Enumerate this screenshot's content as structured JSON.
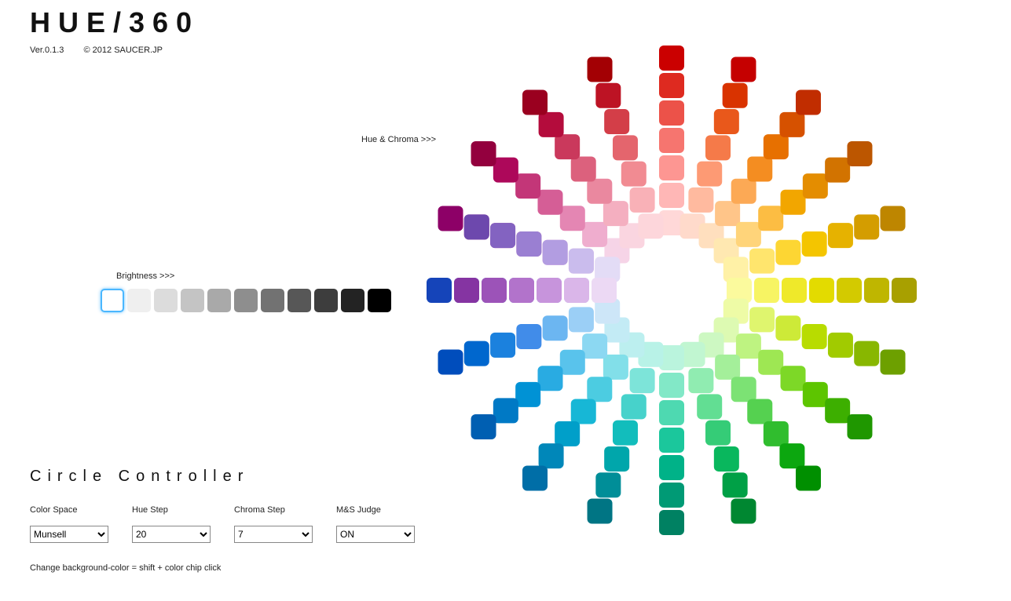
{
  "header": {
    "logo": "HUE/360",
    "version": "Ver.0.1.3",
    "copyright": "© 2012 SAUCER.JP"
  },
  "labels": {
    "hue_chroma": "Hue & Chroma >>>",
    "brightness": "Brightness >>>"
  },
  "brightness": {
    "selected_index": 0,
    "swatches": [
      "#ffffff",
      "#efefef",
      "#dcdcdc",
      "#c4c4c4",
      "#a9a9a9",
      "#8e8e8e",
      "#727272",
      "#575757",
      "#3d3d3d",
      "#232323",
      "#000000"
    ]
  },
  "wheel": {
    "hue_count": 20,
    "chroma_steps": 7,
    "spokes": [
      {
        "angle": -90,
        "colors": [
          "#ffd8d8",
          "#ffb7b6",
          "#fd9692",
          "#f6756f",
          "#ec5249",
          "#de2a20",
          "#cb0000"
        ]
      },
      {
        "angle": -72,
        "colors": [
          "#ffdacb",
          "#ffba9f",
          "#fd9a74",
          "#f57a49",
          "#e9581b",
          "#d93300",
          "#c50000"
        ]
      },
      {
        "angle": -54,
        "colors": [
          "#ffdfbe",
          "#ffc589",
          "#fca955",
          "#f48d21",
          "#e77000",
          "#d65100",
          "#c12d00"
        ]
      },
      {
        "angle": -36,
        "colors": [
          "#ffe8b1",
          "#ffd47a",
          "#fcbd43",
          "#f2a600",
          "#e48d00",
          "#d27300",
          "#bc5600"
        ]
      },
      {
        "angle": -18,
        "colors": [
          "#fff1a6",
          "#ffe56d",
          "#fdd633",
          "#f4c500",
          "#e6b200",
          "#d49d00",
          "#be8600"
        ]
      },
      {
        "angle": 0,
        "colors": [
          "#fbfa9d",
          "#f7f463",
          "#efe92a",
          "#e3db00",
          "#d3ca00",
          "#bfb600",
          "#a8a000"
        ]
      },
      {
        "angle": 18,
        "colors": [
          "#eefba6",
          "#dff56e",
          "#cdea38",
          "#b8dc00",
          "#a1cb00",
          "#88b700",
          "#6da000"
        ]
      },
      {
        "angle": 36,
        "colors": [
          "#ddfab2",
          "#bef381",
          "#9ee753",
          "#7dd827",
          "#5dc500",
          "#3daf00",
          "#1f9700"
        ]
      },
      {
        "angle": 54,
        "colors": [
          "#cdf8c2",
          "#a4ef9a",
          "#7ce274",
          "#55d150",
          "#30bd2e",
          "#0ca70f",
          "#008f00"
        ]
      },
      {
        "angle": 72,
        "colors": [
          "#c1f6d1",
          "#90ecb1",
          "#62de93",
          "#35cc77",
          "#09b75d",
          "#00a046",
          "#008731"
        ]
      },
      {
        "angle": 90,
        "colors": [
          "#baf4dd",
          "#82e8c7",
          "#4ed9b1",
          "#1bc79c",
          "#00b288",
          "#009a75",
          "#008162"
        ]
      },
      {
        "angle": 108,
        "colors": [
          "#b8f2e7",
          "#7de4d9",
          "#47d2cb",
          "#12bdbc",
          "#00a6ab",
          "#008e98",
          "#007584"
        ]
      },
      {
        "angle": 126,
        "colors": [
          "#bcefef",
          "#82dfe9",
          "#4ccce1",
          "#17b7d6",
          "#009fc9",
          "#0087b9",
          "#006ea7"
        ]
      },
      {
        "angle": 144,
        "colors": [
          "#c3ebf5",
          "#8cd8f2",
          "#59c3ec",
          "#29abe2",
          "#0092d5",
          "#0079c5",
          "#005fb2"
        ]
      },
      {
        "angle": 162,
        "colors": [
          "#cde6f8",
          "#9bcff6",
          "#6cb6f1",
          "#418ce9",
          "#1b81de",
          "#0067ce",
          "#004dbc"
        ]
      },
      {
        "angle": 180,
        "colors": [
          "#d8e1f8",
          "#b2c6f5",
          "#8eabef",
          "#6c90e6",
          "#4d76da",
          "#305dcb",
          "#1544b9"
        ]
      },
      {
        "angle": -162,
        "colors": [
          "#f2d4ee",
          "#ebadde",
          "#e086cb",
          "#d15fb5",
          "#be389c",
          "#a70e82",
          "#8d0067"
        ]
      },
      {
        "angle": -144,
        "colors": [
          "#f6d4e7",
          "#efadce",
          "#e486b3",
          "#d55e96",
          "#c33678",
          "#ad085a",
          "#93003e"
        ]
      },
      {
        "angle": -126,
        "colors": [
          "#fad5e0",
          "#f4afc0",
          "#ea889f",
          "#dc617d",
          "#ca395c",
          "#b40c3c",
          "#9a001f"
        ]
      },
      {
        "angle": -108,
        "colors": [
          "#fdd6db",
          "#f9b1b7",
          "#f18b92",
          "#e4656d",
          "#d33e48",
          "#bd1324",
          "#a30004"
        ]
      }
    ],
    "overlay_spokes": [
      {
        "angle": 198,
        "count": 6,
        "colors_start": [
          "#e3dcf6",
          "#cabced",
          "#b29de1",
          "#9a7fd2",
          "#8363c1",
          "#6d48ad"
        ]
      },
      {
        "angle": -180,
        "count": 6,
        "colors_start": [
          "#ecd9f4",
          "#dab6e9",
          "#c794dc",
          "#b273cb",
          "#9c53b8",
          "#8534a2"
        ]
      }
    ]
  },
  "controller": {
    "title": "Circle Controller",
    "groups": [
      {
        "label": "Color Space",
        "value": "Munsell",
        "options": [
          "Munsell"
        ]
      },
      {
        "label": "Hue Step",
        "value": "20",
        "options": [
          "20"
        ]
      },
      {
        "label": "Chroma Step",
        "value": "7",
        "options": [
          "7"
        ]
      },
      {
        "label": "M&S Judge",
        "value": "ON",
        "options": [
          "ON"
        ]
      }
    ],
    "hint": "Change background-color = shift + color chip click"
  }
}
